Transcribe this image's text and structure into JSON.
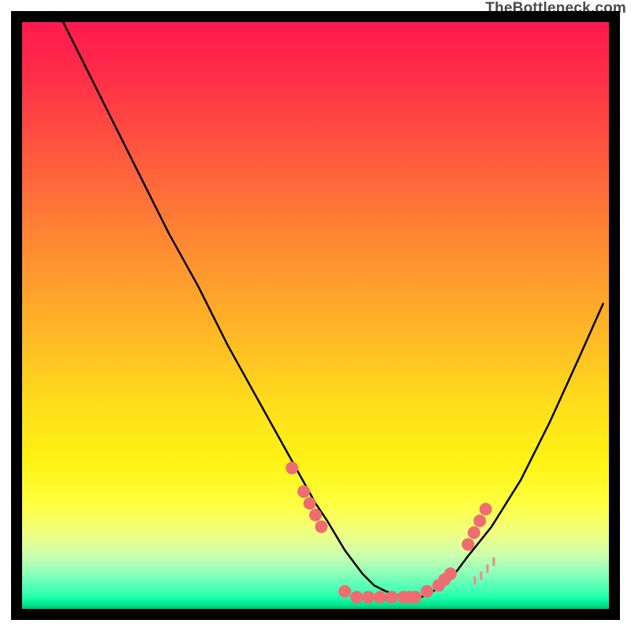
{
  "watermark": "TheBottleneck.com",
  "chart_data": {
    "type": "line",
    "title": "",
    "xlabel": "",
    "ylabel": "",
    "xlim": [
      0,
      100
    ],
    "ylim": [
      0,
      100
    ],
    "grid": false,
    "legend": false,
    "background": "red-to-green vertical gradient",
    "series": [
      {
        "name": "bottleneck-curve",
        "stroke": "#000000",
        "x": [
          7,
          10,
          15,
          20,
          25,
          30,
          35,
          40,
          45,
          50,
          52,
          55,
          58,
          60,
          62,
          65,
          68,
          70,
          73,
          76,
          80,
          85,
          90,
          95,
          99
        ],
        "values": [
          100,
          94,
          84,
          74,
          64,
          55,
          45,
          36,
          27,
          18,
          15,
          10,
          6,
          4,
          3,
          2,
          2,
          3,
          5,
          9,
          14,
          22,
          32,
          43,
          52
        ]
      }
    ],
    "markers": {
      "name": "highlighted-points",
      "fill": "#ee6d70",
      "points": [
        {
          "x": 46,
          "y": 24
        },
        {
          "x": 48,
          "y": 20
        },
        {
          "x": 49,
          "y": 18
        },
        {
          "x": 50,
          "y": 16
        },
        {
          "x": 51,
          "y": 14
        },
        {
          "x": 55,
          "y": 3
        },
        {
          "x": 57,
          "y": 2
        },
        {
          "x": 59,
          "y": 2
        },
        {
          "x": 61,
          "y": 2
        },
        {
          "x": 63,
          "y": 2
        },
        {
          "x": 65,
          "y": 2
        },
        {
          "x": 66,
          "y": 2
        },
        {
          "x": 67,
          "y": 2
        },
        {
          "x": 69,
          "y": 3
        },
        {
          "x": 71,
          "y": 4
        },
        {
          "x": 72,
          "y": 5
        },
        {
          "x": 73,
          "y": 6
        },
        {
          "x": 76,
          "y": 11
        },
        {
          "x": 77,
          "y": 13
        },
        {
          "x": 78,
          "y": 15
        },
        {
          "x": 79,
          "y": 17
        }
      ]
    }
  }
}
